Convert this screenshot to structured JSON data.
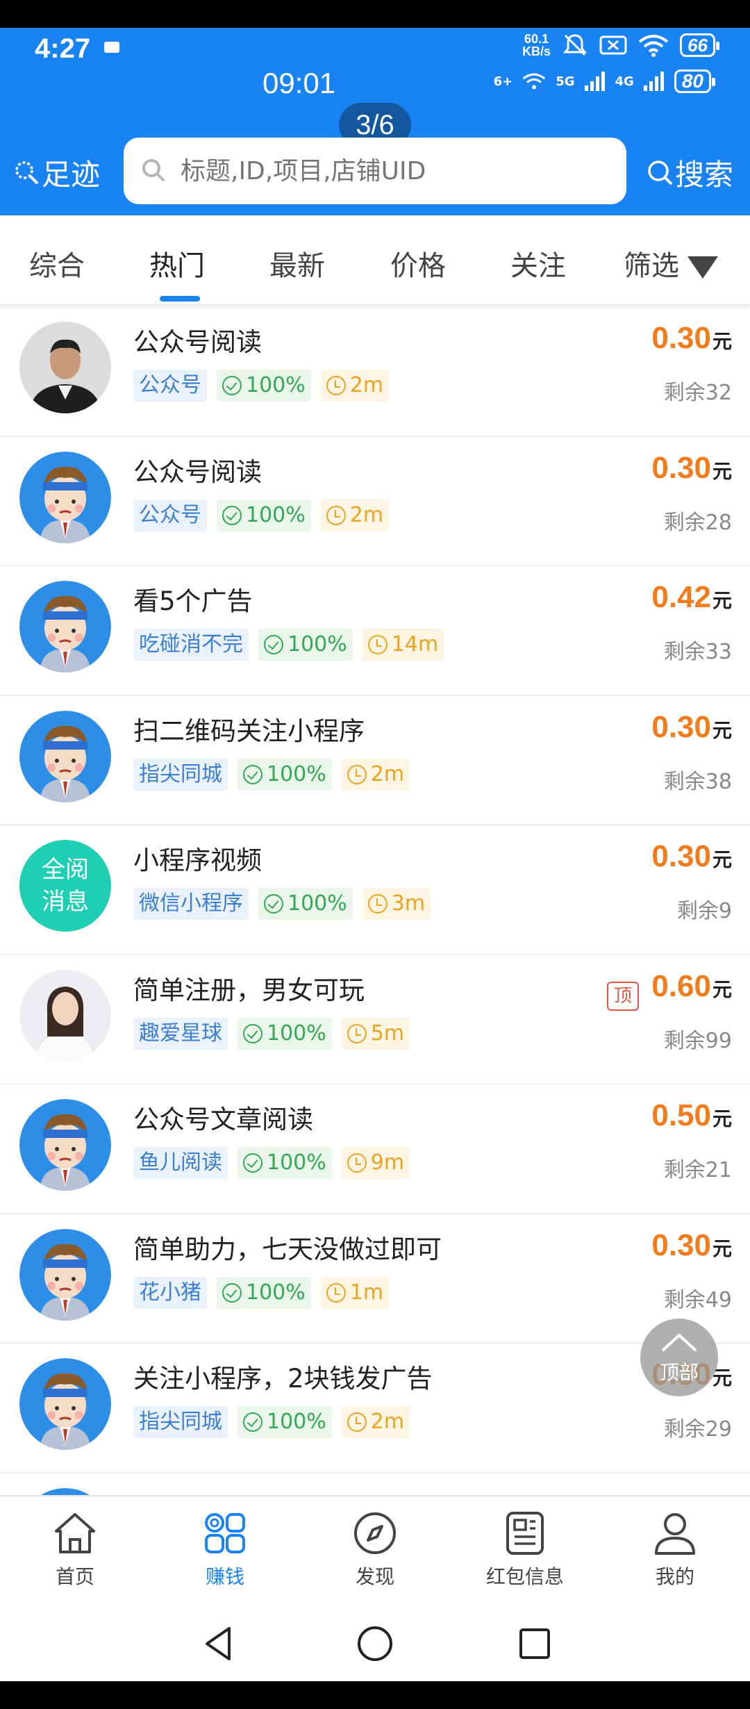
{
  "status": {
    "time": "4:27",
    "net_speed_value": "60.1",
    "net_speed_unit": "KB/s",
    "battery_1": "66",
    "call_time": "09:01",
    "call_badge": "3/6",
    "wifi_label": "6+",
    "sig_5g": "5G",
    "sig_4g": "4G",
    "battery_2": "80"
  },
  "header": {
    "footprint_label": "足迹",
    "search_placeholder": "标题,ID,项目,店铺UID",
    "search_label": "搜索"
  },
  "tabs": [
    {
      "label": "综合"
    },
    {
      "label": "热门"
    },
    {
      "label": "最新"
    },
    {
      "label": "价格"
    },
    {
      "label": "关注"
    },
    {
      "label": "筛选"
    }
  ],
  "active_tab": "热门",
  "tasks": [
    {
      "title": "公众号阅读",
      "tag": "公众号",
      "rate": "100%",
      "time": "2m",
      "price": "0.30",
      "unit": "元",
      "remain": "剩余32",
      "avatar": "man-photo"
    },
    {
      "title": "公众号阅读",
      "tag": "公众号",
      "rate": "100%",
      "time": "2m",
      "price": "0.30",
      "unit": "元",
      "remain": "剩余28",
      "avatar": "cartoon"
    },
    {
      "title": "看5个广告",
      "tag": "吃碰消不完",
      "rate": "100%",
      "time": "14m",
      "price": "0.42",
      "unit": "元",
      "remain": "剩余33",
      "avatar": "cartoon"
    },
    {
      "title": "扫二维码关注小程序",
      "tag": "指尖同城",
      "rate": "100%",
      "time": "2m",
      "price": "0.30",
      "unit": "元",
      "remain": "剩余38",
      "avatar": "cartoon"
    },
    {
      "title": "小程序视频",
      "tag": "微信小程序",
      "rate": "100%",
      "time": "3m",
      "price": "0.30",
      "unit": "元",
      "remain": "剩余9",
      "avatar": "text",
      "avatar_text_1": "全阅",
      "avatar_text_2": "消息"
    },
    {
      "title": "简单注册，男女可玩",
      "tag": "趣爱星球",
      "rate": "100%",
      "time": "5m",
      "price": "0.60",
      "unit": "元",
      "remain": "剩余99",
      "avatar": "woman-photo",
      "badge": "顶"
    },
    {
      "title": "公众号文章阅读",
      "tag": "鱼儿阅读",
      "rate": "100%",
      "time": "9m",
      "price": "0.50",
      "unit": "元",
      "remain": "剩余21",
      "avatar": "cartoon"
    },
    {
      "title": "简单助力，七天没做过即可",
      "tag": "花小猪",
      "rate": "100%",
      "time": "1m",
      "price": "0.30",
      "unit": "元",
      "remain": "剩余49",
      "avatar": "cartoon"
    },
    {
      "title": "关注小程序，2块钱发广告",
      "tag": "指尖同城",
      "rate": "100%",
      "time": "2m",
      "price": "0.30",
      "unit": "元",
      "remain": "剩余29",
      "avatar": "cartoon"
    }
  ],
  "to_top_label": "顶部",
  "bottom_nav": [
    {
      "label": "首页",
      "icon": "home-icon"
    },
    {
      "label": "赚钱",
      "icon": "grid-icon"
    },
    {
      "label": "发现",
      "icon": "compass-icon"
    },
    {
      "label": "红包信息",
      "icon": "news-icon"
    },
    {
      "label": "我的",
      "icon": "user-icon"
    }
  ],
  "active_nav": "赚钱",
  "colors": {
    "primary": "#1a83f4",
    "price": "#f07c1d",
    "rate_green": "#32a852",
    "time_orange": "#e8a423",
    "tag_blue": "#3a7fd0"
  }
}
